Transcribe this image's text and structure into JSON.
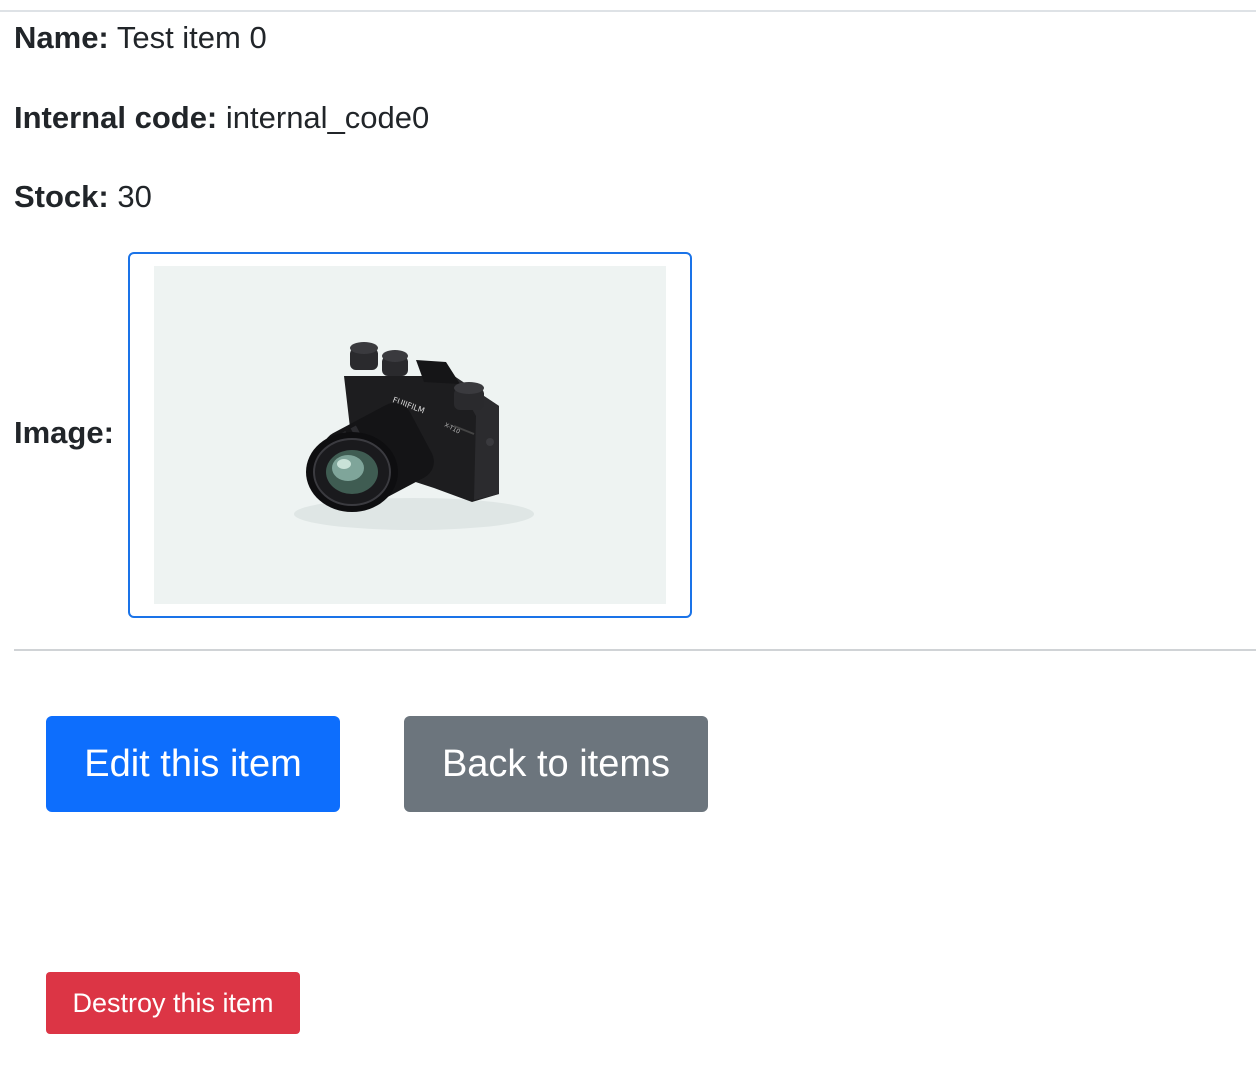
{
  "item": {
    "name_label": "Name:",
    "name_value": "Test item 0",
    "code_label": "Internal code:",
    "code_value": "internal_code0",
    "stock_label": "Stock:",
    "stock_value": "30",
    "image_label": "Image:"
  },
  "image": {
    "depicts": "camera-photo",
    "brand_text": "FUJIFILM",
    "model_text": "X-T10"
  },
  "actions": {
    "edit_label": "Edit this item",
    "back_label": "Back to items",
    "destroy_label": "Destroy this item"
  },
  "colors": {
    "primary": "#0d6efd",
    "secondary": "#6c757d",
    "danger": "#dc3545",
    "image_border": "#1a73e8"
  }
}
